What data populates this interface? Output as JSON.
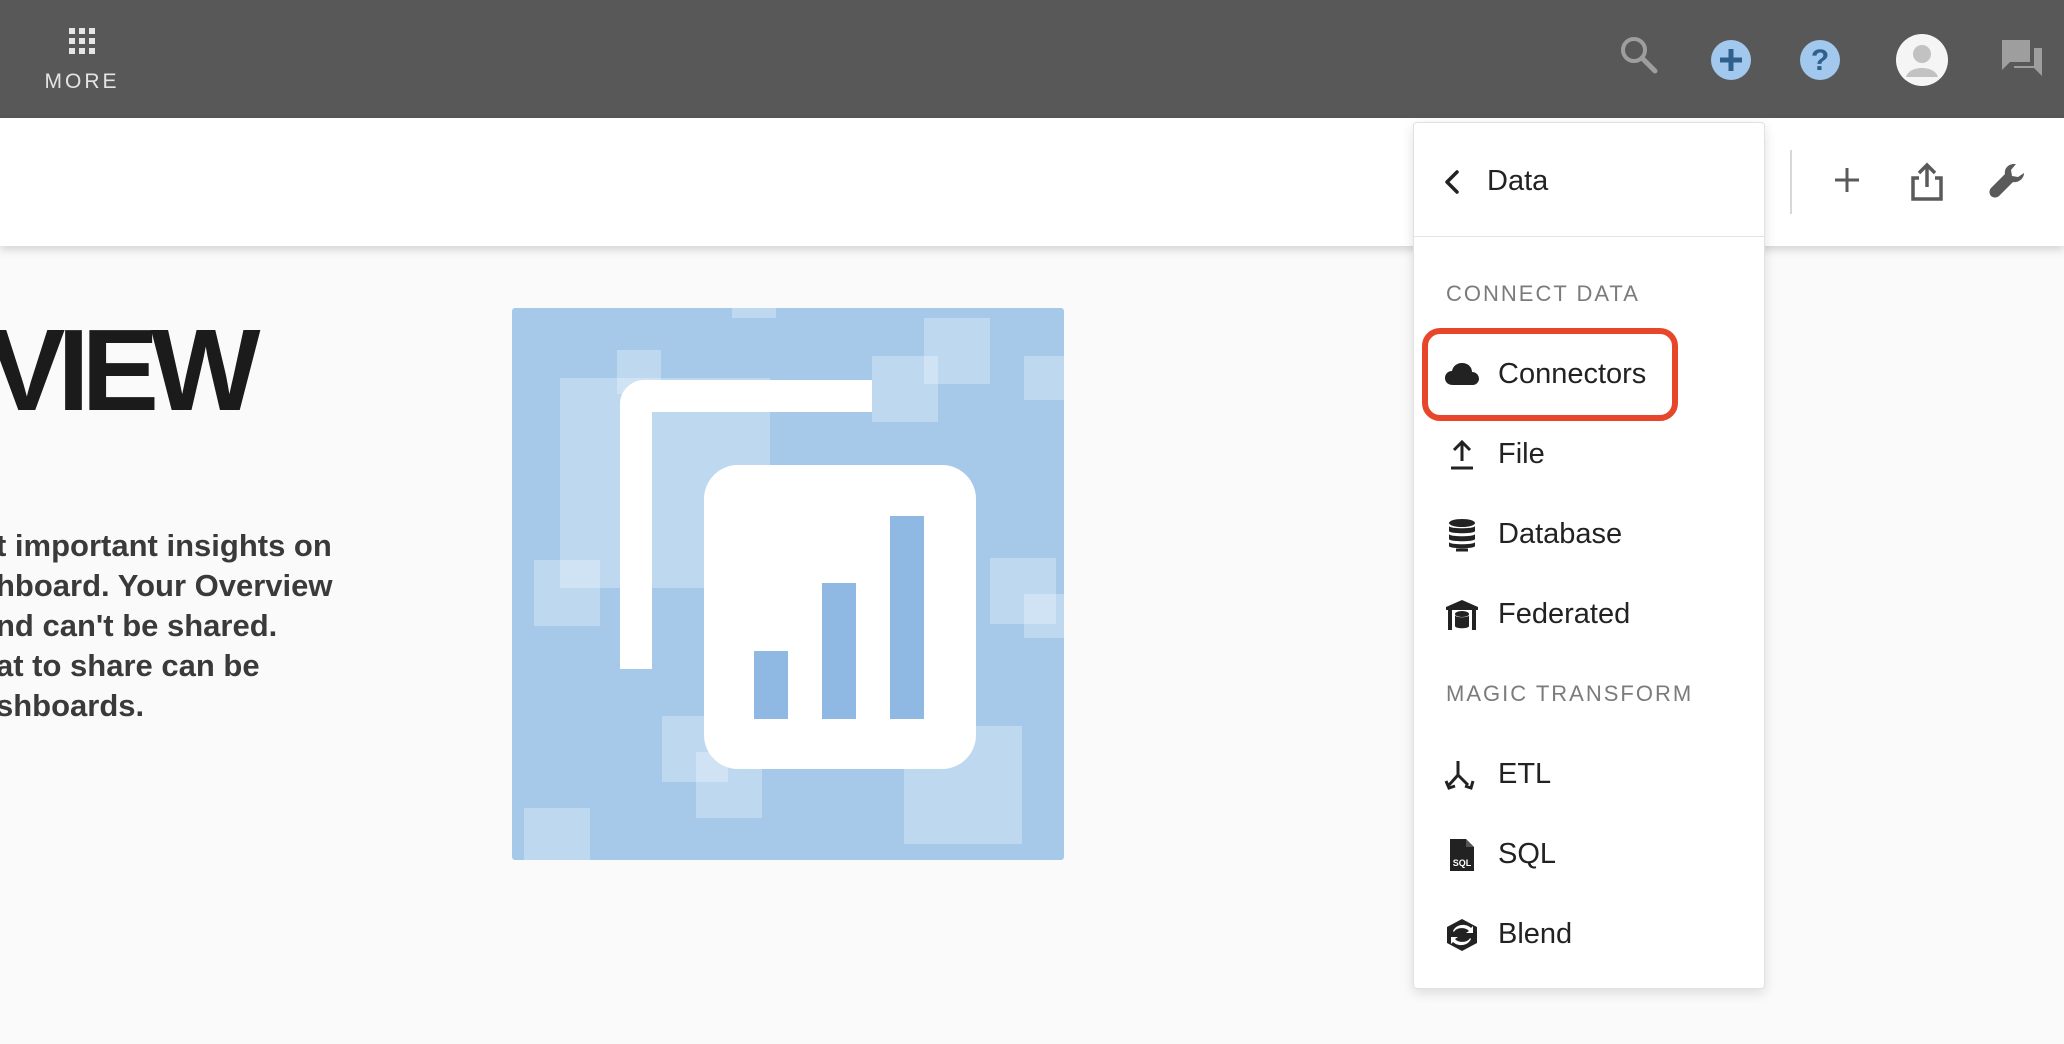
{
  "topbar": {
    "more_label": "MORE",
    "icons": [
      "search-icon",
      "add-circle-icon",
      "help-icon",
      "avatar-icon",
      "chat-icon"
    ],
    "accent_color": "#a3c8ee"
  },
  "subbar": {
    "icons": [
      "plus-icon",
      "share-icon",
      "wrench-icon"
    ]
  },
  "content": {
    "heading": "VIEW",
    "description_lines": [
      "t important insights on",
      "hboard. Your Overview",
      "nd can't be shared.",
      "at to share can be",
      "shboards."
    ]
  },
  "panel": {
    "title": "Data",
    "section_connect": "CONNECT DATA",
    "connect_items": [
      {
        "label": "Connectors",
        "icon": "cloud-icon"
      },
      {
        "label": "File",
        "icon": "upload-icon"
      },
      {
        "label": "Database",
        "icon": "database-icon"
      },
      {
        "label": "Federated",
        "icon": "federated-icon"
      }
    ],
    "section_magic": "MAGIC TRANSFORM",
    "magic_items": [
      {
        "label": "ETL",
        "icon": "etl-icon"
      },
      {
        "label": "SQL",
        "icon": "sql-file-icon"
      },
      {
        "label": "Blend",
        "icon": "blend-icon"
      }
    ],
    "highlight_color": "#e8462a"
  }
}
